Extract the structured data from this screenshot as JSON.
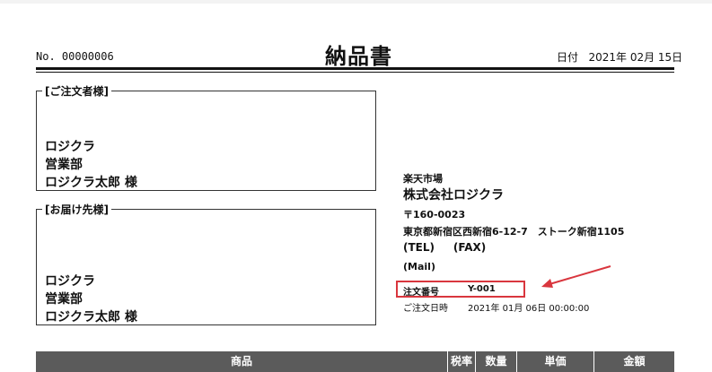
{
  "header": {
    "doc_no": "No. 00000006",
    "title": "納品書",
    "date_label": "日付",
    "date_value": "2021年 02月 15日"
  },
  "orderer": {
    "legend": "[ご注文者様]",
    "lines": [
      "ロジクラ",
      "営業部",
      "ロジクラ太郎 様"
    ]
  },
  "delivery": {
    "legend": "[お届け先様]",
    "lines": [
      "ロジクラ",
      "営業部",
      "ロジクラ太郎 様"
    ]
  },
  "shop": {
    "store": "楽天市場",
    "company": "株式会社ロジクラ",
    "postal": "〒160-0023",
    "address": "東京都新宿区西新宿6-12-7　ストーク新宿1105",
    "tel": "(TEL)",
    "fax": "(FAX)",
    "mail": "(Mail)",
    "order_no_label": "注文番号",
    "order_no": "Y-001",
    "order_date_label": "ご注文日時",
    "order_date": "2021年 01月 06日 00:00:00"
  },
  "highlight_color": "#d9363e",
  "table": {
    "columns": [
      "商品",
      "税率",
      "数量",
      "単価",
      "金額"
    ]
  }
}
